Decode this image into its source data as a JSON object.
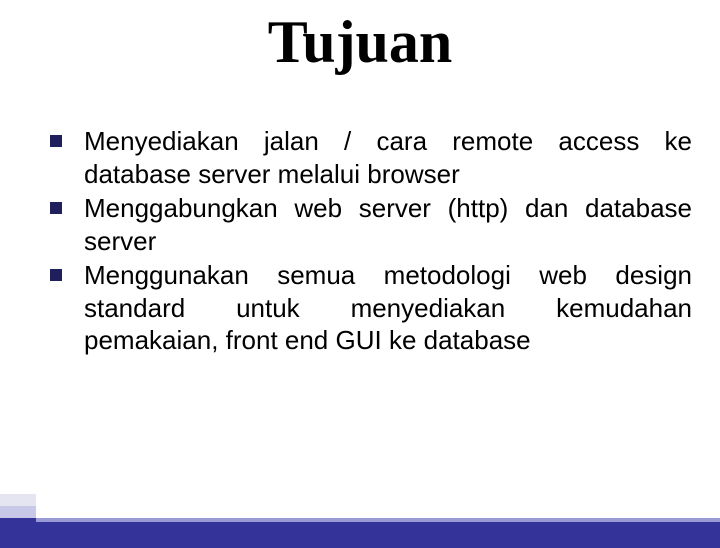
{
  "title": "Tujuan",
  "bullets": [
    {
      "text": "Menyediakan jalan / cara remote access ke database server melalui browser"
    },
    {
      "text": "Menggabungkan web server (http) dan database server"
    },
    {
      "text": "Menggunakan semua metodologi web design standard untuk menyediakan kemudahan pemakaian, front end GUI ke database"
    }
  ]
}
